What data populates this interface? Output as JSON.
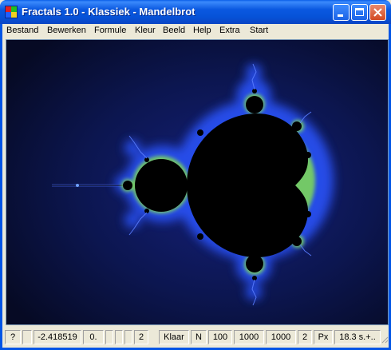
{
  "window": {
    "title": "Fractals 1.0 - Klassiek - Mandelbrot"
  },
  "menu": {
    "items": [
      "Bestand",
      "Bewerken",
      "Formule",
      "Kleur",
      "Beeld",
      "Help",
      "Extra",
      "Start"
    ]
  },
  "status": {
    "help": "?",
    "blank1": "",
    "coord": "-2.418519",
    "coord2": "0.",
    "blank2": "",
    "blank3": "",
    "blank4": "",
    "count": "2",
    "state": "Klaar",
    "mode": "N",
    "v1": "100",
    "v2": "1000",
    "v3": "1000",
    "v4": "2",
    "unit": "Px",
    "time": "18.3 s.+.."
  },
  "colors": {
    "background": "#0a1230",
    "glow": "#1a3cff",
    "edge": "#7cd65a",
    "set": "#000000"
  }
}
